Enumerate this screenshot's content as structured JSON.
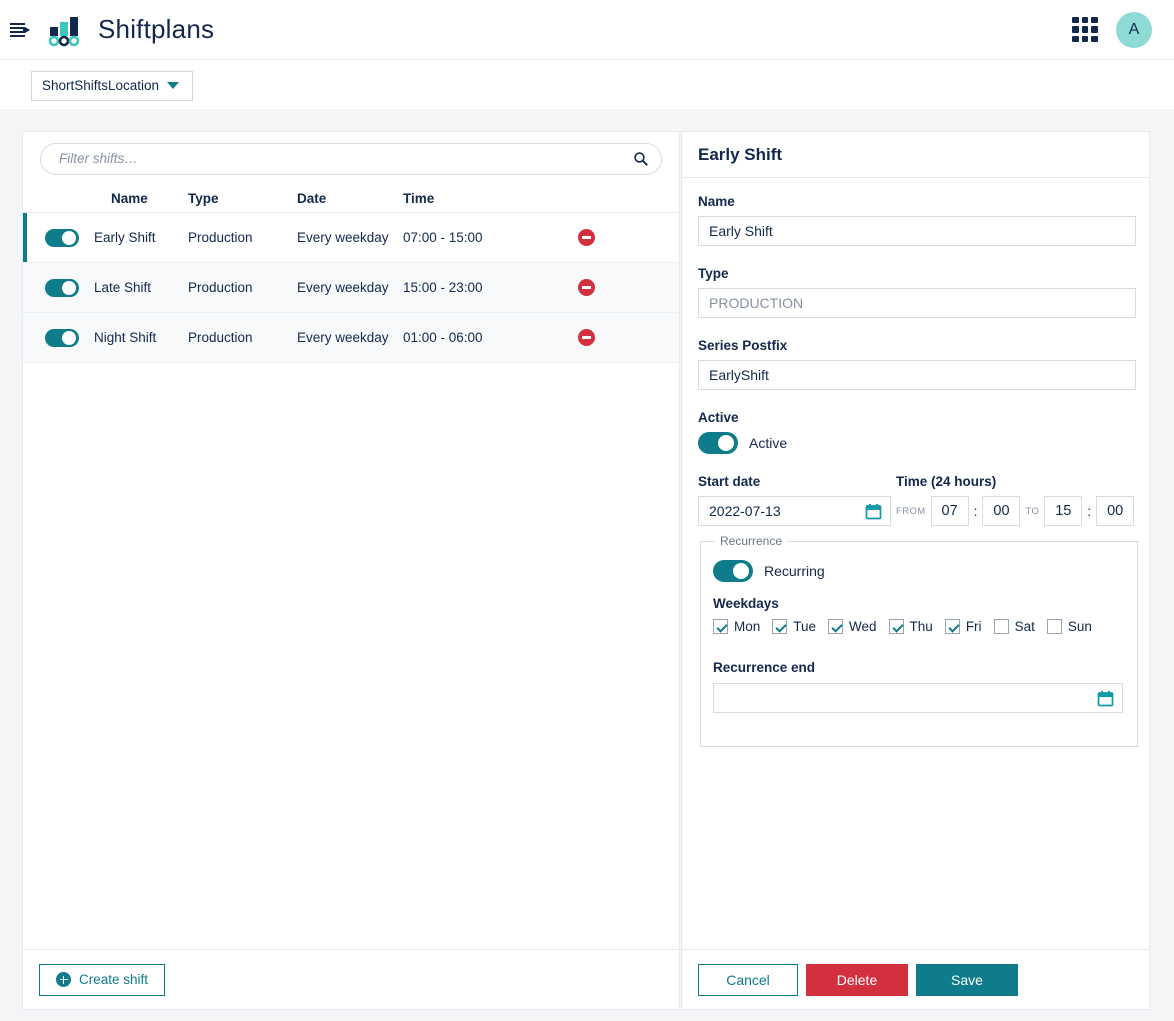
{
  "appbar": {
    "menu_icon": "menu-expand-icon",
    "logo_icon": "shiftplans-logo",
    "title": "Shiftplans",
    "apps_icon": "apps-grid-icon",
    "avatar_initial": "A"
  },
  "locationbar": {
    "selected_location": "ShortShiftsLocation",
    "caret_icon": "chevron-down-icon"
  },
  "shift_list": {
    "filter_placeholder": "Filter shifts…",
    "filter_value": "",
    "search_icon": "search-icon",
    "columns": [
      "Name",
      "Type",
      "Date",
      "Time"
    ],
    "rows": [
      {
        "active": true,
        "name": "Early Shift",
        "type": "Production",
        "date": "Every weekday",
        "time": "07:00 - 15:00",
        "selected": true
      },
      {
        "active": true,
        "name": "Late Shift",
        "type": "Production",
        "date": "Every weekday",
        "time": "15:00 - 23:00",
        "selected": false
      },
      {
        "active": true,
        "name": "Night Shift",
        "type": "Production",
        "date": "Every weekday",
        "time": "01:00 - 06:00",
        "selected": false
      }
    ],
    "create_label": "Create shift",
    "create_icon": "plus-circle-icon",
    "delete_icon": "remove-circle-icon"
  },
  "detail": {
    "heading": "Early Shift",
    "name_label": "Name",
    "name_value": "Early Shift",
    "type_label": "Type",
    "type_value": "PRODUCTION",
    "postfix_label": "Series Postfix",
    "postfix_value": "EarlyShift",
    "active_label": "Active",
    "active_toggle_label": "Active",
    "active_on": true,
    "start_date_label": "Start date",
    "start_date_value": "2022-07-13",
    "calendar_icon": "calendar-icon",
    "time_label": "Time (24 hours)",
    "time_from_tag": "FROM",
    "time_from_hour": "07",
    "time_from_minute": "00",
    "time_to_tag": "TO",
    "time_to_hour": "15",
    "time_to_minute": "00",
    "time_separator": ":",
    "recurrence_legend": "Recurrence",
    "recurring_label": "Recurring",
    "recurring_on": true,
    "weekdays_label": "Weekdays",
    "weekdays": [
      {
        "label": "Mon",
        "checked": true
      },
      {
        "label": "Tue",
        "checked": true
      },
      {
        "label": "Wed",
        "checked": true
      },
      {
        "label": "Thu",
        "checked": true
      },
      {
        "label": "Fri",
        "checked": true
      },
      {
        "label": "Sat",
        "checked": false
      },
      {
        "label": "Sun",
        "checked": false
      }
    ],
    "recurrence_end_label": "Recurrence end",
    "recurrence_end_value": "",
    "cancel_label": "Cancel",
    "delete_label": "Delete",
    "save_label": "Save"
  },
  "colors": {
    "teal": "#0e7c8a",
    "teal_light": "#3dc6bd",
    "navy": "#12284c",
    "red": "#d3303f",
    "avatar_bg": "#8ddbd4",
    "page_bg": "#f4f5f7"
  }
}
